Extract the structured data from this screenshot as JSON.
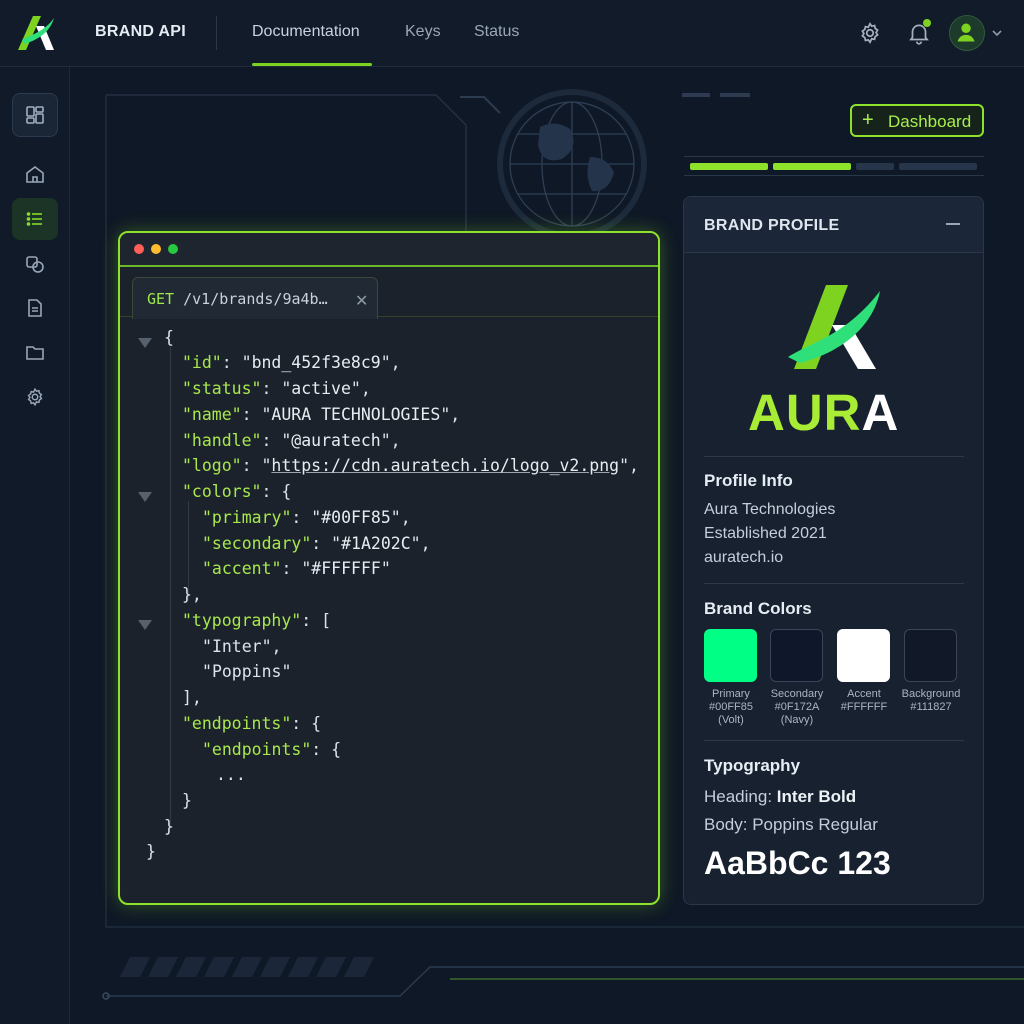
{
  "app": {
    "brand_title": "BRAND API",
    "nav_tabs": [
      "Documentation",
      "Keys",
      "Status"
    ],
    "active_tab": "Documentation"
  },
  "topbar_icons": [
    "gear-icon",
    "bell-icon",
    "user-avatar",
    "chevron-down-icon"
  ],
  "sidebar": {
    "items": [
      {
        "name": "dashboard-grid",
        "icon": "grid-icon"
      },
      {
        "name": "home",
        "icon": "home-icon"
      },
      {
        "name": "list",
        "icon": "list-icon",
        "active": true
      },
      {
        "name": "palette",
        "icon": "palette-icon"
      },
      {
        "name": "document",
        "icon": "document-icon"
      },
      {
        "name": "folder",
        "icon": "folder-icon"
      },
      {
        "name": "settings",
        "icon": "gear-icon"
      }
    ]
  },
  "request_tab": {
    "method": "GET",
    "path": "/v1/brands/9a4b…"
  },
  "json_response": {
    "id": "bnd_452f3e8c9",
    "status": "active",
    "name": "AURA TECHNOLOGIES",
    "handle": "@auratech",
    "logo": "https://cdn.auratech.io/logo_v2.png",
    "colors_primary": "#00FF85",
    "colors_secondary": "#1A202C",
    "colors_accent": "#FFFFFF",
    "typography_0": "Inter",
    "typography_1": "Poppins",
    "ellipsis": "..."
  },
  "dashboard_button": {
    "label": "Dashboard"
  },
  "brand_profile": {
    "title": "BRAND PROFILE",
    "logo_word_green": "AUR",
    "logo_word_white": "A",
    "profile_info_title": "Profile Info",
    "company": "Aura Technologies",
    "established": "Established 2021",
    "website": "auratech.io",
    "brand_colors_title": "Brand Colors",
    "swatches": [
      {
        "label": "Primary\n#00FF85\n(Volt)",
        "color": "#00FF85"
      },
      {
        "label": "Secondary\n#0F172A\n(Navy)",
        "color": "#0F172A"
      },
      {
        "label": "Accent\n#FFFFFF",
        "color": "#FFFFFF"
      },
      {
        "label": "Background\n#111827",
        "color": "#111827"
      }
    ],
    "typography_title": "Typography",
    "heading_label": "Heading:",
    "heading_value": "Inter Bold",
    "body_label": "Body:",
    "body_value": "Poppins Regular",
    "sample_text": "AaBbCc 123"
  },
  "colors": {
    "accent_green": "#7ED321",
    "background": "#0F1826",
    "panel": "#17212F"
  }
}
